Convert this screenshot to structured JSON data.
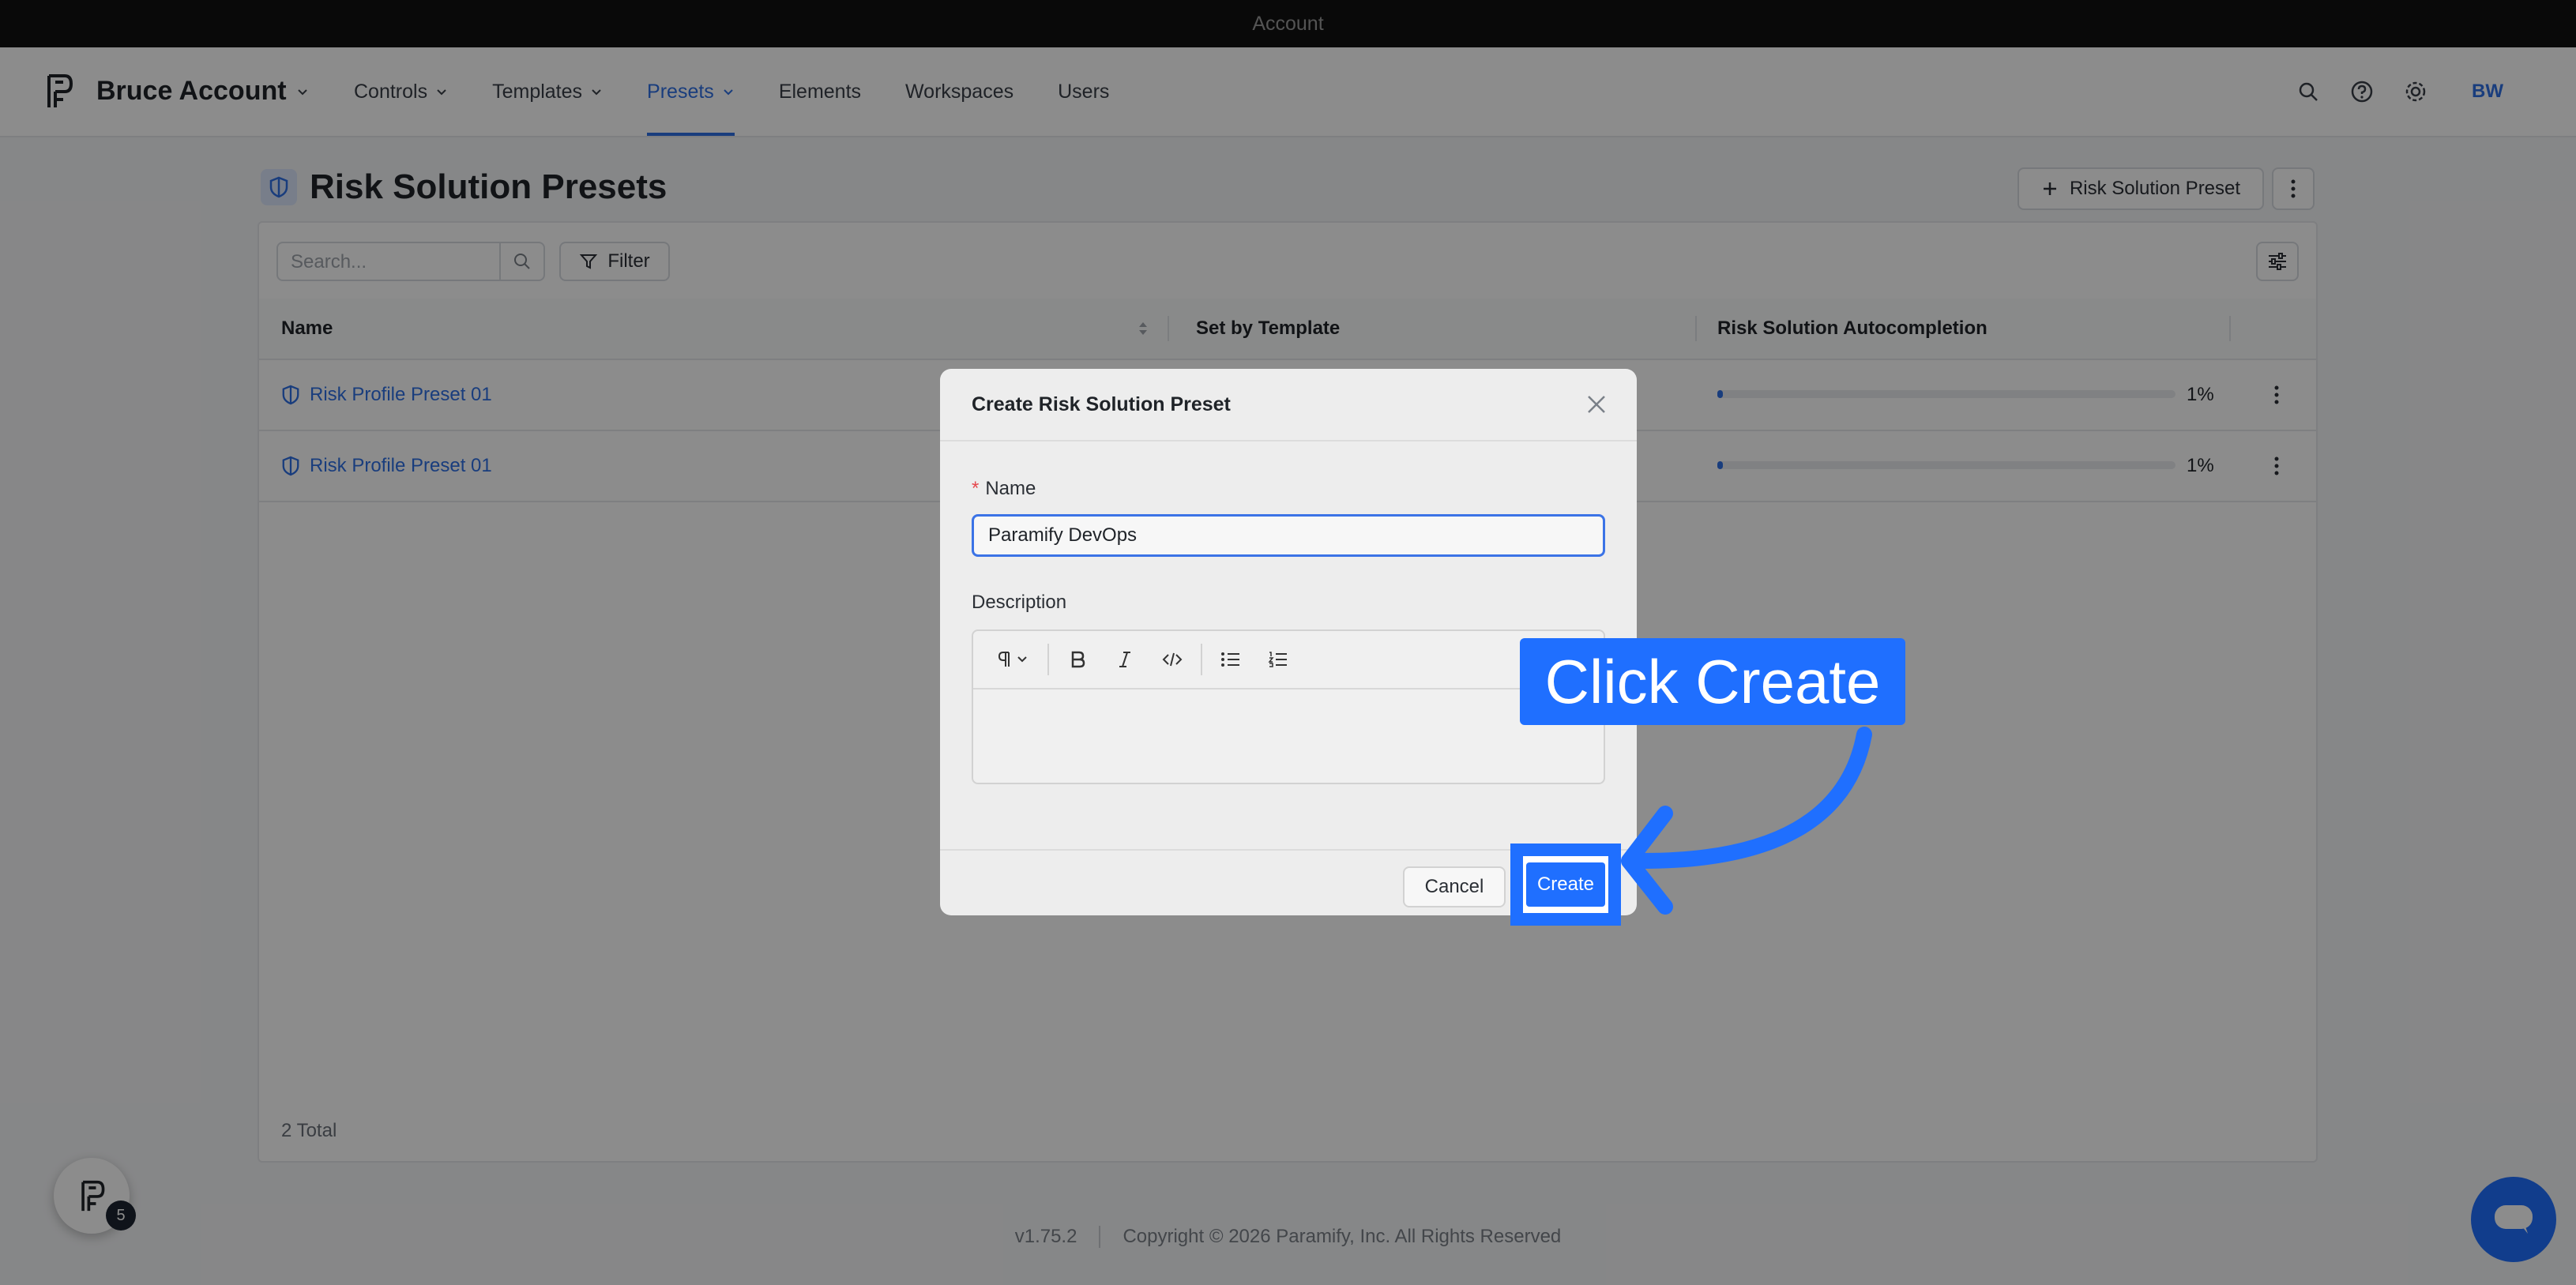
{
  "os_bar": {
    "title": "Account"
  },
  "header": {
    "account_name": "Bruce Account",
    "nav": [
      {
        "label": "Controls",
        "has_menu": true,
        "active": false
      },
      {
        "label": "Templates",
        "has_menu": true,
        "active": false
      },
      {
        "label": "Presets",
        "has_menu": true,
        "active": true
      },
      {
        "label": "Elements",
        "has_menu": false,
        "active": false
      },
      {
        "label": "Workspaces",
        "has_menu": false,
        "active": false
      },
      {
        "label": "Users",
        "has_menu": false,
        "active": false
      }
    ],
    "user_initials": "BW",
    "icons": [
      "search-icon",
      "help-icon",
      "gear-icon"
    ]
  },
  "page": {
    "title": "Risk Solution Presets",
    "add_button_label": "Risk Solution Preset",
    "search_placeholder": "Search...",
    "filter_label": "Filter",
    "columns": [
      "Name",
      "Set by Template",
      "Risk Solution Autocompletion"
    ],
    "rows": [
      {
        "name": "Risk Profile Preset 01",
        "set_by_template": "",
        "autocompletion": "1%",
        "progress": 0.01
      },
      {
        "name": "Risk Profile Preset 01",
        "set_by_template": "",
        "autocompletion": "1%",
        "progress": 0.01
      }
    ],
    "total": "2 Total"
  },
  "footer": {
    "version": "v1.75.2",
    "copyright": "Copyright © 2026 Paramify, Inc. All Rights Reserved"
  },
  "floating": {
    "badge_count": "5"
  },
  "modal": {
    "title": "Create Risk Solution Preset",
    "name_label": "Name",
    "name_value": "Paramify DevOps",
    "description_label": "Description",
    "editor_tools": [
      "paragraph",
      "bold",
      "italic",
      "code",
      "bullet-list",
      "ordered-list"
    ],
    "cancel_label": "Cancel",
    "create_label": "Create"
  },
  "annotation": {
    "callout_text": "Click Create",
    "accent": "#1f6fff"
  },
  "colors": {
    "brand_blue": "#2f6fe4",
    "annotation_blue": "#1f6fff",
    "overlay": "rgba(0,0,0,0.45)"
  }
}
